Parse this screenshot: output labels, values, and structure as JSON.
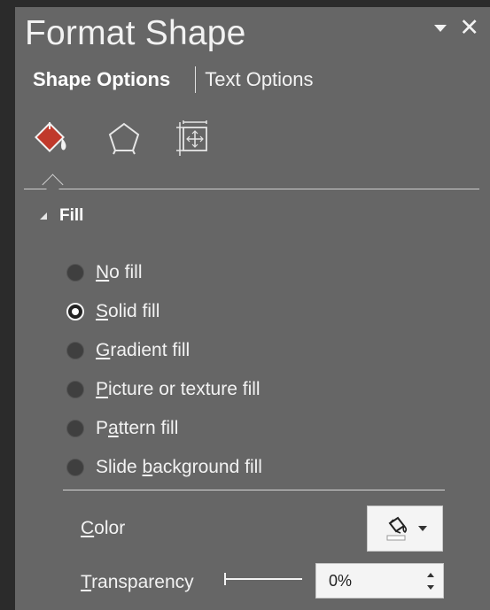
{
  "pane": {
    "title": "Format Shape",
    "dropdown_icon": "chevron-down-icon",
    "close_icon": "close-icon",
    "close_glyph": "✕"
  },
  "option_tabs": {
    "shape_options": "Shape Options",
    "text_options": "Text Options"
  },
  "icon_tabs": [
    {
      "name": "fill-line-icon",
      "active": true,
      "accent": "#c0392b"
    },
    {
      "name": "effects-pentagon-icon",
      "active": false
    },
    {
      "name": "size-properties-icon",
      "active": false
    }
  ],
  "fill": {
    "title": "Fill",
    "options": [
      {
        "key": "N",
        "rest": "o fill",
        "label": "No fill",
        "selected": false
      },
      {
        "key": "S",
        "rest": "olid fill",
        "label": "Solid fill",
        "selected": true
      },
      {
        "key": "G",
        "rest": "radient fill",
        "label": "Gradient fill",
        "selected": false
      },
      {
        "key": "P",
        "rest": "icture or texture fill",
        "label": "Picture or texture fill",
        "selected": false
      },
      {
        "pre": "P",
        "key": "a",
        "rest": "ttern fill",
        "label": "Pattern fill",
        "selected": false
      },
      {
        "pre": "Slide ",
        "key": "b",
        "rest": "ackground fill",
        "label": "Slide background fill",
        "selected": false
      }
    ],
    "color": {
      "label_key": "C",
      "label_rest": "olor",
      "icon": "paint-bucket-icon",
      "swatch": "#ffffff"
    },
    "transparency": {
      "label_key": "T",
      "label_rest": "ransparency",
      "value": "0%",
      "level": 0
    }
  },
  "colors": {
    "pane_bg": "#666666",
    "accent": "#c0392b"
  }
}
